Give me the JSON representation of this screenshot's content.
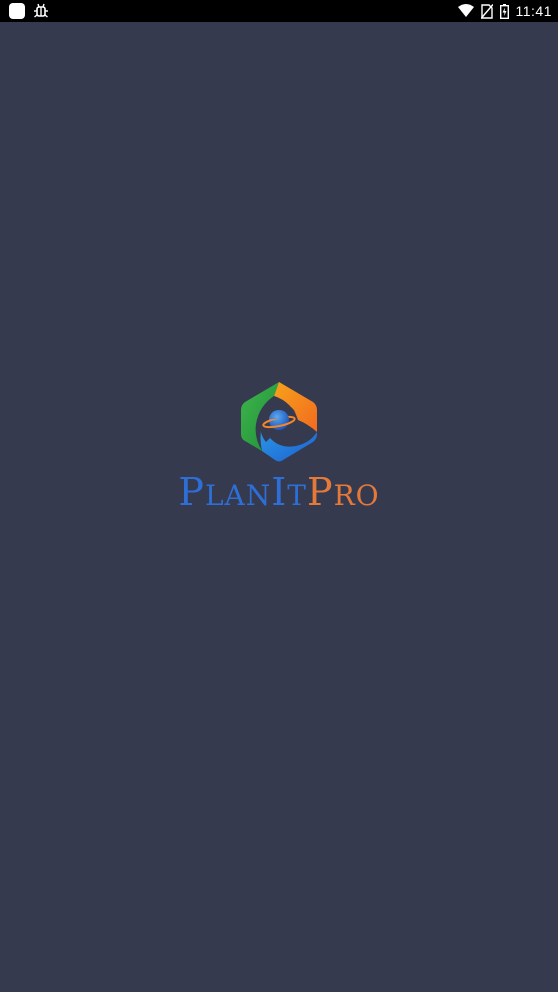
{
  "status_bar": {
    "time": "11:41",
    "icons": [
      "app-square-icon",
      "bug-icon",
      "wifi-icon",
      "no-sim-icon",
      "battery-charging-icon"
    ]
  },
  "splash": {
    "logo_icon": "planet-hexagon-logo-icon",
    "wordmark": {
      "part1_cap": "P",
      "part1_rest": "LAN",
      "part2_cap": "I",
      "part2_rest": "T",
      "part3_cap": "P",
      "part3_rest": "RO"
    },
    "colors": {
      "background": "#363a4f",
      "wordmark_blue": "#2d6fd6",
      "wordmark_orange": "#e4793a"
    }
  }
}
